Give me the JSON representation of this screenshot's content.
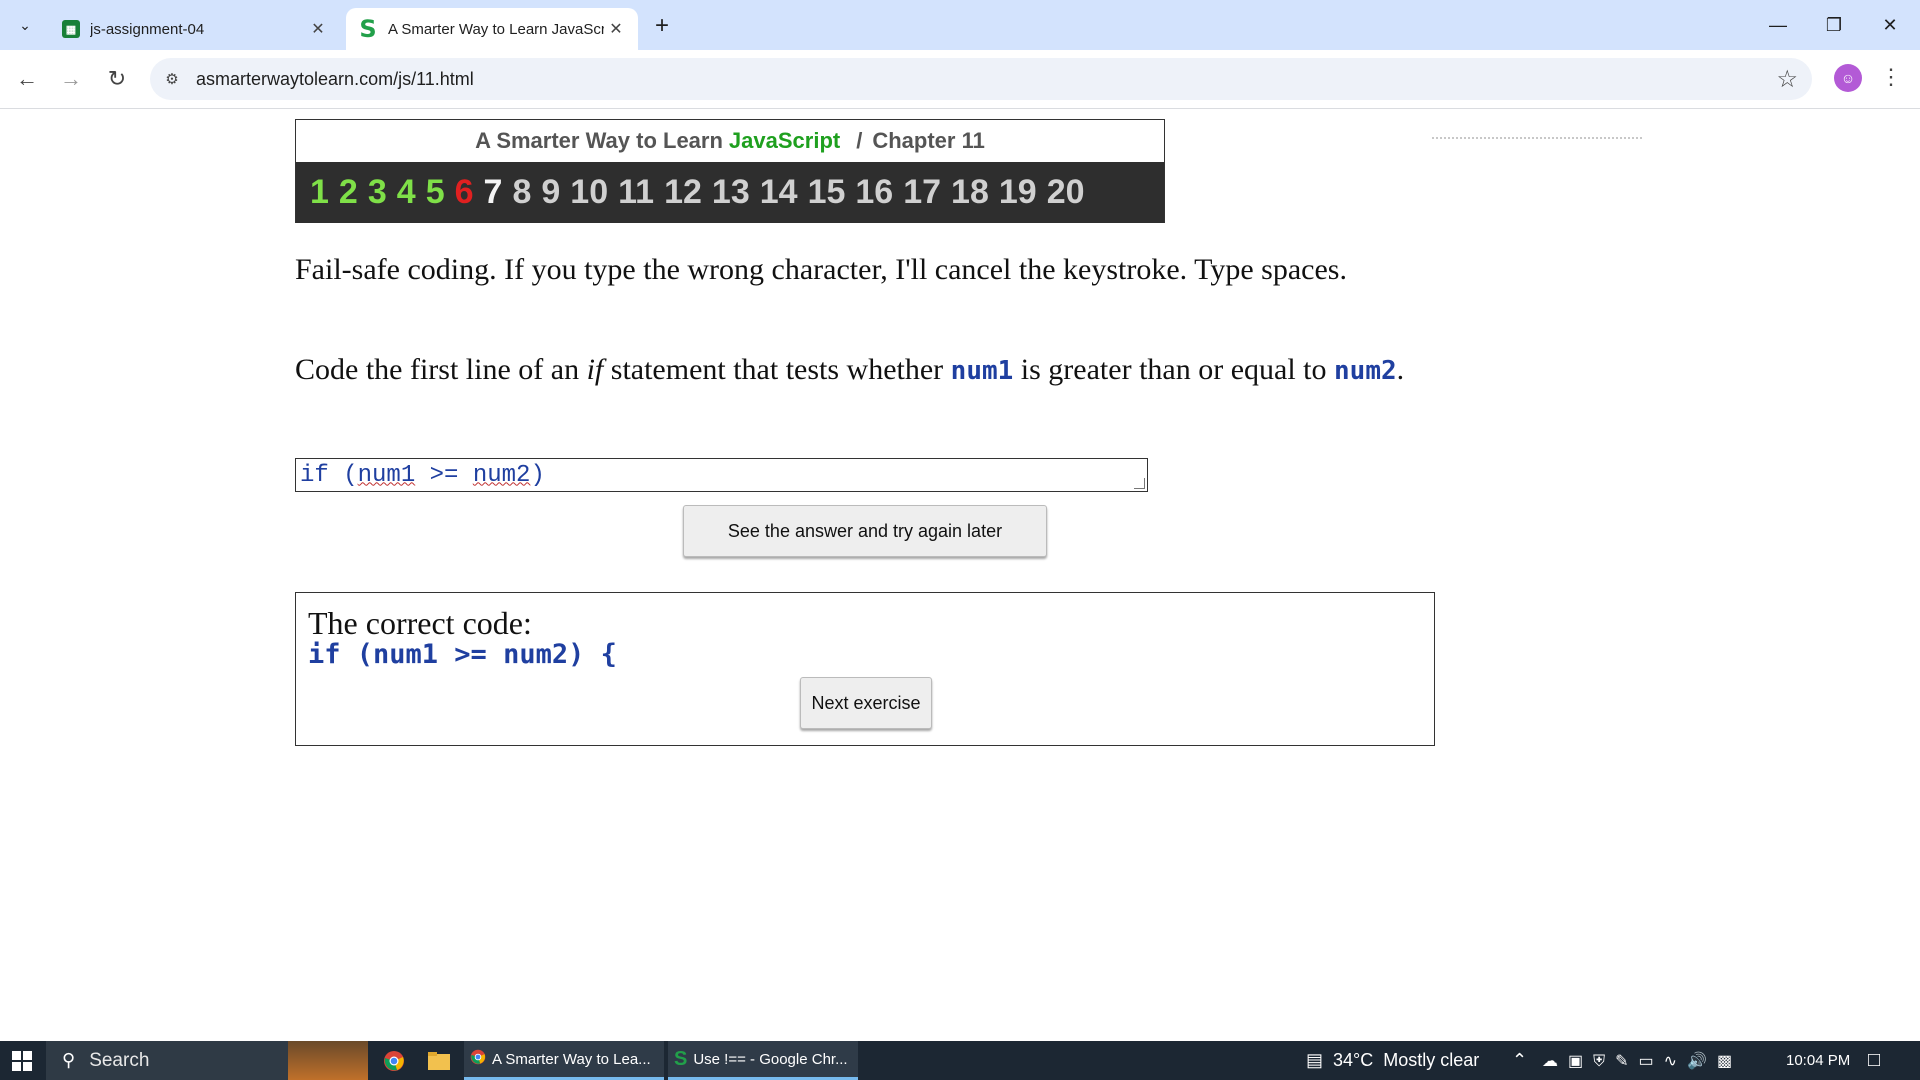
{
  "browser": {
    "tabs": [
      {
        "title": "js-assignment-04",
        "icon": "sheets-icon",
        "active": false
      },
      {
        "title": "A Smarter Way to Learn JavaScri",
        "icon": "s-logo-icon",
        "active": true
      }
    ],
    "url": "asmarterwaytolearn.com/js/11.html",
    "profile_initial": "☺"
  },
  "chapter_header": {
    "prefix": "A Smarter Way to Learn",
    "brand": "JavaScript",
    "separator": "/",
    "chapter": "Chapter 11",
    "numbers": [
      "1",
      "2",
      "3",
      "4",
      "5",
      "6",
      "7",
      "8",
      "9",
      "10",
      "11",
      "12",
      "13",
      "14",
      "15",
      "16",
      "17",
      "18",
      "19",
      "20"
    ],
    "current": "6"
  },
  "instructions": {
    "line1": "Fail-safe coding. If you type the wrong character, I'll cancel the keystroke. Type spaces.",
    "line2_part1": "Code the first line of an ",
    "line2_em": "if",
    "line2_part2": " statement that tests whether ",
    "line2_code1": "num1",
    "line2_part3": " is greater than or equal to ",
    "line2_code2": "num2",
    "line2_part4": "."
  },
  "answer": {
    "kw": "if (",
    "v1": "num1",
    "op": " >= ",
    "v2": "num2",
    "close": ")"
  },
  "buttons": {
    "see_answer": "See the answer and try again later",
    "next": "Next exercise"
  },
  "correct": {
    "label": "The correct code:",
    "code": "if (num1 >= num2) {"
  },
  "taskbar": {
    "search": "Search",
    "apps": [
      {
        "label": "A Smarter Way to Lea..."
      },
      {
        "label": "Use !== - Google Chr..."
      }
    ],
    "weather": "34°C  Mostly clear",
    "time": "10:04 PM"
  },
  "colors": {
    "brand_green": "#1fa01f",
    "done_chapter": "#7fe048",
    "current_chapter": "#e02020",
    "code_blue": "#1f3fa0"
  }
}
